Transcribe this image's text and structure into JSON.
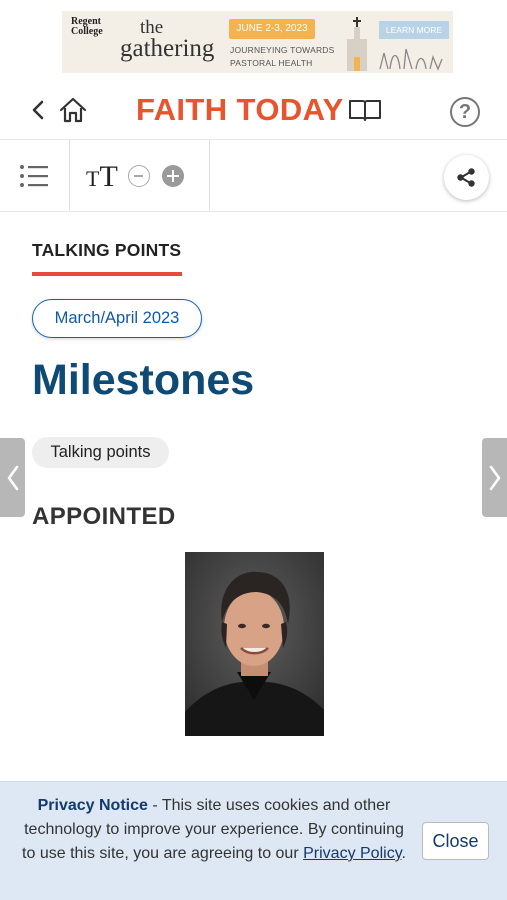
{
  "ad": {
    "logo_line1": "Regent",
    "logo_line2": "College",
    "word_the": "the",
    "word_gathering": "gathering",
    "date": "JUNE 2-3, 2023",
    "tagline_line1": "JOURNEYING TOWARDS",
    "tagline_line2": "PASTORAL HEALTH",
    "cta": "LEARN MORE"
  },
  "header": {
    "brand": "FAITH TODAY",
    "help": "?"
  },
  "toolbar": {
    "font_small": "T",
    "font_big": "T"
  },
  "article": {
    "section_label": "TALKING POINTS",
    "issue": "March/April 2023",
    "title": "Milestones",
    "tag": "Talking points",
    "subhead": "APPOINTED"
  },
  "privacy": {
    "heading": "Privacy Notice",
    "body": " - This site uses cookies and other technology to improve your experience. By continuing to use this site, you are agreeing to our ",
    "link": "Privacy Policy",
    "end": ".",
    "close": "Close"
  },
  "colors": {
    "brand": "#e8542e",
    "title": "#0e4a73",
    "accent_bar": "#e64a3b",
    "pill_border": "#0f63b7",
    "privacy_bg": "#dde8f4"
  }
}
